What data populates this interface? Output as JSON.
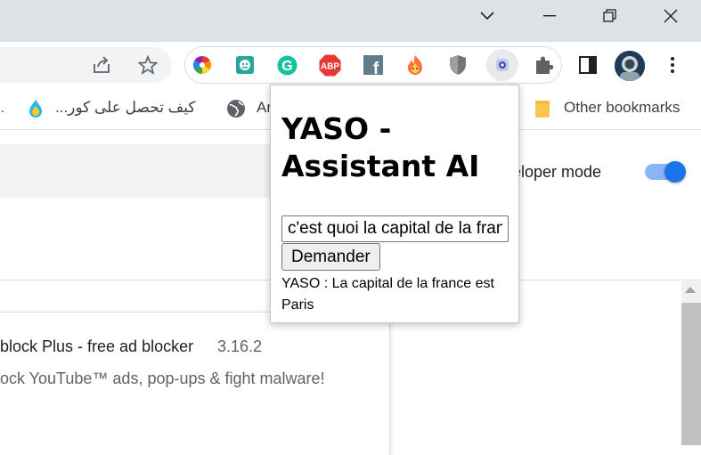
{
  "extensions": [
    {
      "icon": "color-wheel-icon"
    },
    {
      "icon": "robot-icon"
    },
    {
      "icon": "grammarly-icon",
      "letter": "G"
    },
    {
      "icon": "adblock-icon",
      "letter": "ABP"
    },
    {
      "icon": "facebook-icon",
      "letter": "f"
    },
    {
      "icon": "fire-icon"
    },
    {
      "icon": "shield-icon"
    },
    {
      "icon": "yaso-icon"
    }
  ],
  "bookmarks": {
    "item1": "كيف تحصل على كور...",
    "item2": "Ar",
    "other": "Other bookmarks"
  },
  "page": {
    "developer_mode": "veloper mode",
    "developer_mode_on": true,
    "extension_title": "block Plus - free ad blocker",
    "extension_version": "3.16.2",
    "extension_desc": "ock YouTube™ ads, pop-ups & fight malware!"
  },
  "popup": {
    "title": "YASO - Assistant AI",
    "input_value": "c'est quoi la capital de la france",
    "button": "Demander",
    "answer": "YASO : La capital de la france est Paris"
  }
}
